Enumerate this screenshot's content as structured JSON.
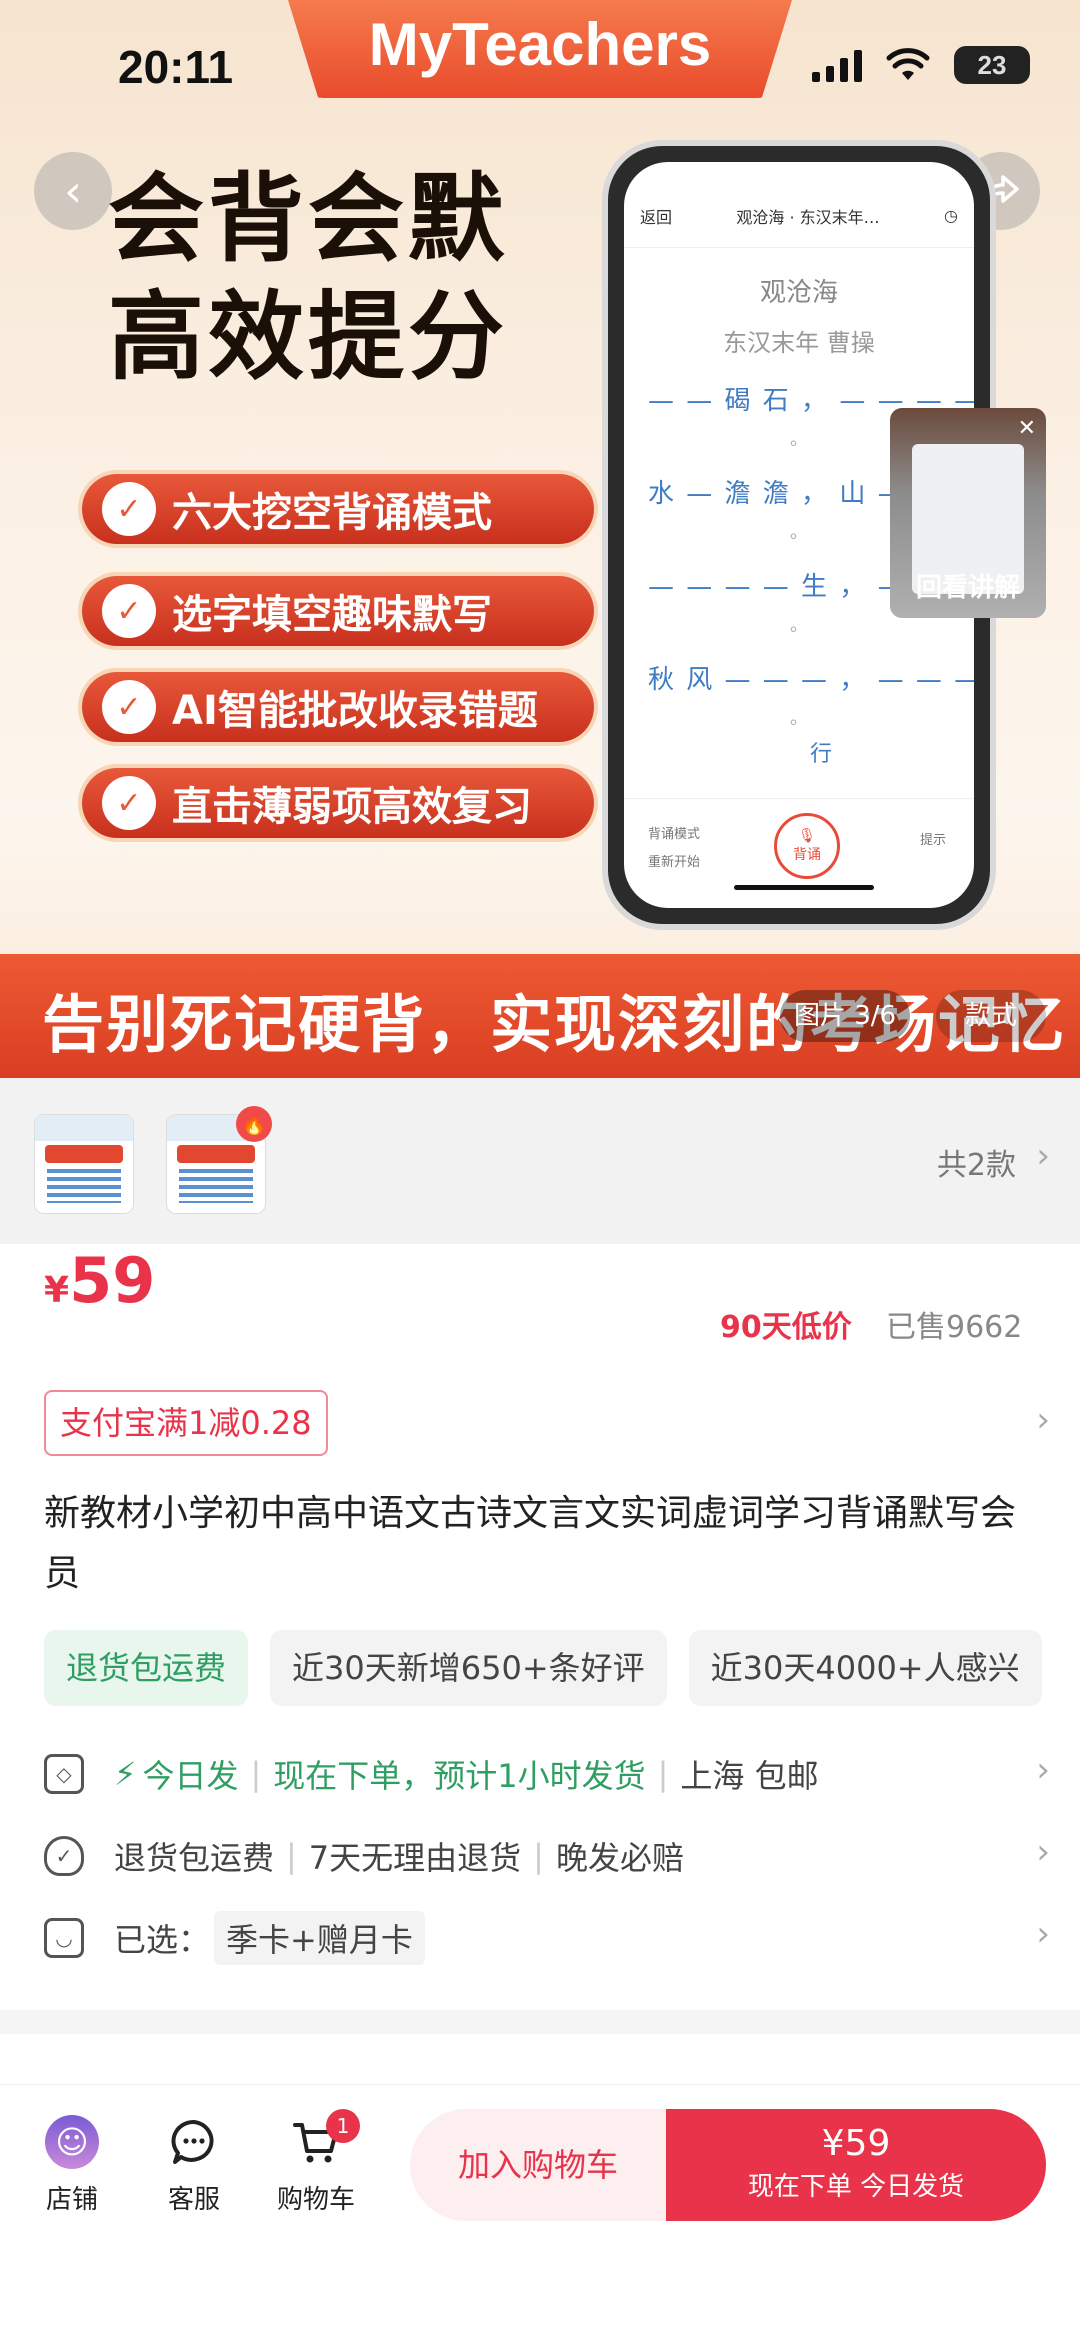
{
  "status": {
    "time": "20:11",
    "battery": "23"
  },
  "hero": {
    "brand": "MyTeachers",
    "headline_1": "会背会默",
    "headline_2": "高效提分",
    "features": [
      "六大挖空背诵模式",
      "选字填空趣味默写",
      "AI智能批改收录错题",
      "直击薄弱项高效复习"
    ],
    "phone": {
      "nav_back": "返回",
      "nav_title": "观沧海 · 东汉末年…",
      "poem_title": "观沧海",
      "poem_author": "东汉末年  曹操",
      "lines": [
        "— — 碣 石 ，  — — — —",
        "水 — 澹 澹 ，  山 — —",
        "— — — — 生 ，  — — — —",
        "秋 风 — — — ，  — — — —",
        "行"
      ],
      "mode": "背诵模式",
      "restart": "重新开始",
      "mic": "背诵",
      "tip": "提示"
    },
    "video_label": "回看讲解",
    "banner": "告别死记硬背，实现深刻的考场记忆",
    "image_counter": "图片 3/6",
    "style_tag": "款式"
  },
  "variants": {
    "count_label": "共2款"
  },
  "product": {
    "price_symbol": "¥",
    "price": "59",
    "low_price": "90天低价",
    "sold": "已售9662",
    "coupon": "支付宝满1减0.28",
    "title": "新教材小学初中高中语文古诗文言文实词虚词学习背诵默写会员",
    "tags": [
      "退货包运费",
      "近30天新增650+条好评",
      "近30天4000+人感兴"
    ],
    "ship_today": "今日发",
    "ship_desc": "现在下单，预计1小时发货",
    "ship_loc": "上海 包邮",
    "service_1": "退货包运费",
    "service_2": "7天无理由退货",
    "service_3": "晚发必赔",
    "selected_label": "已选：",
    "selected_value": "季卡+赠月卡"
  },
  "bottom": {
    "shop": "店铺",
    "service": "客服",
    "cart": "购物车",
    "cart_badge": "1",
    "add_cart": "加入购物车",
    "buy_price": "¥59",
    "buy_sub": "现在下单 今日发货"
  }
}
